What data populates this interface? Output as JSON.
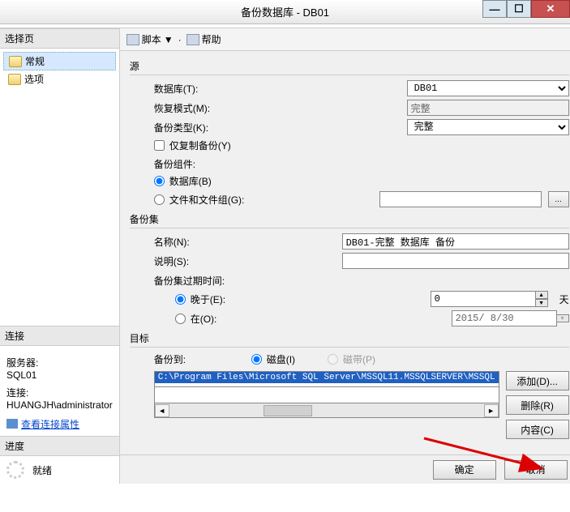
{
  "window": {
    "title": "备份数据库 - DB01"
  },
  "left": {
    "select_page_hdr": "选择页",
    "pages": [
      {
        "label": "常规"
      },
      {
        "label": "选项"
      }
    ],
    "connection_hdr": "连接",
    "server_label": "服务器:",
    "server_value": "SQL01",
    "conn_label": "连接:",
    "conn_value": "HUANGJH\\administrator",
    "view_conn_props": "查看连接属性",
    "progress_hdr": "进度",
    "progress_status": "就绪"
  },
  "toolbar": {
    "script": "脚本",
    "dropdown_glyph": "▼",
    "help": "帮助"
  },
  "form": {
    "source_hdr": "源",
    "database_label": "数据库(T):",
    "database_value": "DB01",
    "recovery_label": "恢复模式(M):",
    "recovery_value": "完整",
    "backup_type_label": "备份类型(K):",
    "backup_type_value": "完整",
    "copy_only_label": "仅复制备份(Y)",
    "component_label": "备份组件:",
    "component_db": "数据库(B)",
    "component_fg": "文件和文件组(G):",
    "backupset_hdr": "备份集",
    "name_label": "名称(N):",
    "name_value": "DB01-完整 数据库 备份",
    "desc_label": "说明(S):",
    "desc_value": "",
    "expire_label": "备份集过期时间:",
    "expire_after_label": "晚于(E):",
    "expire_after_value": "0",
    "expire_after_unit": "天",
    "expire_on_label": "在(O):",
    "expire_on_value": "2015/ 8/30",
    "dest_hdr": "目标",
    "dest_to_label": "备份到:",
    "dest_disk": "磁盘(I)",
    "dest_tape": "磁带(P)",
    "dest_path": "C:\\Program Files\\Microsoft SQL Server\\MSSQL11.MSSQLSERVER\\MSSQL",
    "btn_add": "添加(D)...",
    "btn_remove": "删除(R)",
    "btn_contents": "内容(C)"
  },
  "footer": {
    "ok": "确定",
    "cancel": "取消"
  }
}
